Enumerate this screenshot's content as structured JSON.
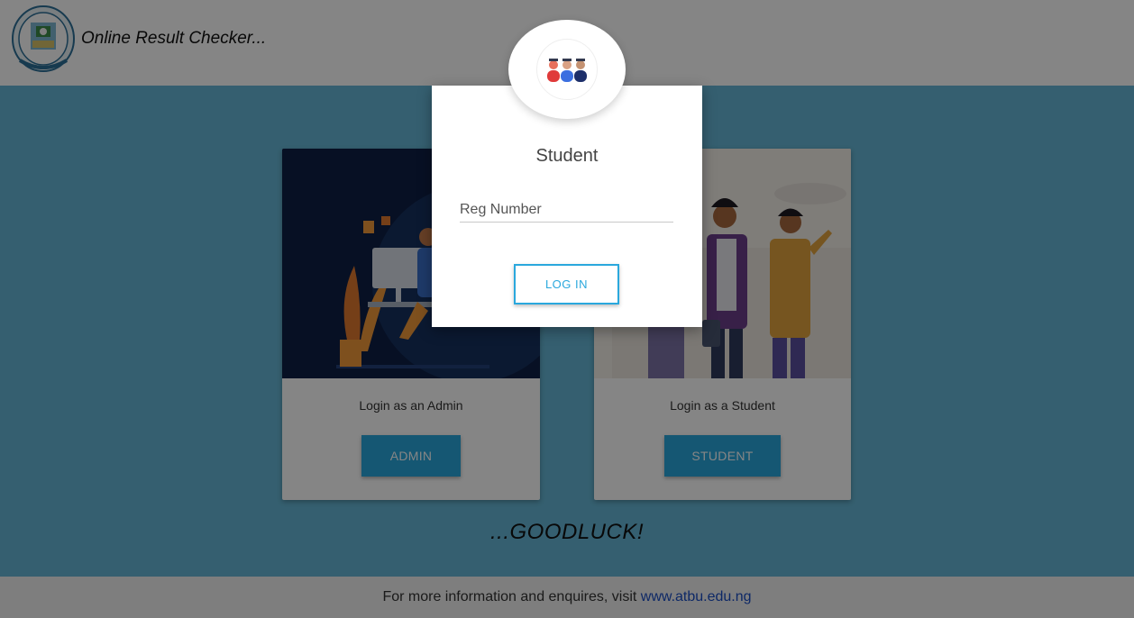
{
  "header": {
    "site_title": "Online Result Checker...",
    "logo_icon": "university-seal-icon"
  },
  "cards": {
    "admin": {
      "label": "Login as an Admin",
      "button": "ADMIN",
      "image_icon": "admin-at-desk-illustration"
    },
    "student": {
      "label": "Login as a Student",
      "button": "STUDENT",
      "image_icon": "students-illustration"
    }
  },
  "goodluck": "...GOODLUCK!",
  "footer": {
    "text": "For more information and enquires, visit ",
    "link": "www.atbu.edu.ng"
  },
  "modal": {
    "avatar_icon": "students-group-icon",
    "title": "Student",
    "reg_placeholder": "Reg Number",
    "reg_value": "",
    "login_button": "LOG IN"
  },
  "colors": {
    "accent": "#2aa8dd",
    "main_bg": "#66b7d6",
    "overlay": "rgba(0,0,0,0.48)"
  }
}
